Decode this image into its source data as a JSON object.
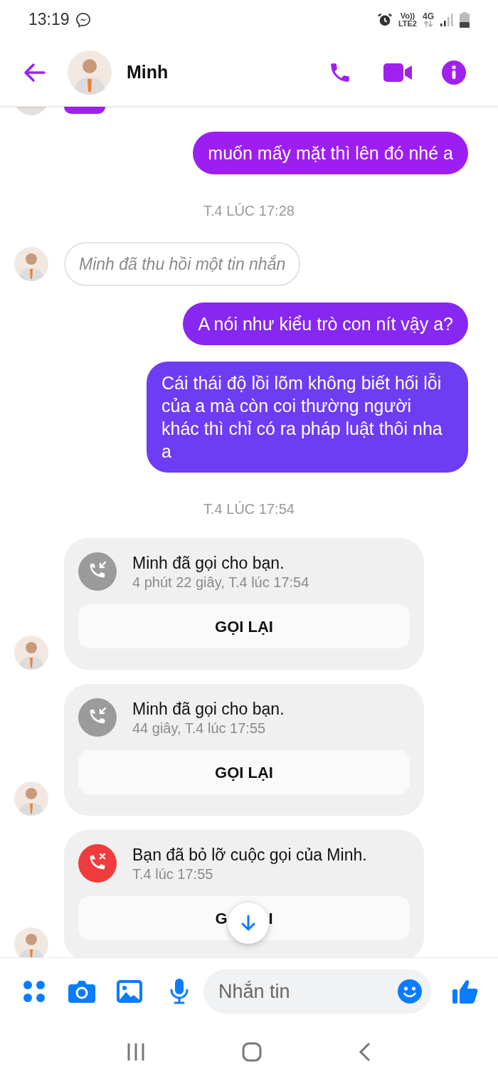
{
  "status_bar": {
    "time": "13:19",
    "volte": "Vo))",
    "lte": "LTE2",
    "data": "4G"
  },
  "header": {
    "name": "Minh"
  },
  "messages": [
    {
      "kind": "sent",
      "text": "muốn mấy mặt thì lên đó nhé a"
    },
    {
      "kind": "timestamp",
      "text": "T.4 LÚC 17:28"
    },
    {
      "kind": "recalled",
      "text": "Minh đã thu hồi một tin nhắn"
    },
    {
      "kind": "sent",
      "text": "A nói như kiểu trò con nít vậy a?"
    },
    {
      "kind": "sent",
      "text": "Cái thái độ lồi lõm không biết hối lỗi của a mà còn coi thường người khác thì chỉ có ra pháp luật thôi nha a"
    },
    {
      "kind": "timestamp",
      "text": "T.4 LÚC 17:54"
    },
    {
      "kind": "call",
      "missed": false,
      "title": "Minh đã gọi cho bạn.",
      "detail": "4 phút 22 giây, T.4 lúc 17:54",
      "button": "GỌI LẠI"
    },
    {
      "kind": "call",
      "missed": false,
      "title": "Minh đã gọi cho bạn.",
      "detail": "44 giây, T.4 lúc 17:55",
      "button": "GỌI LẠI"
    },
    {
      "kind": "call",
      "missed": true,
      "title": "Bạn đã bỏ lỡ cuộc gọi của Minh.",
      "detail": "T.4 lúc 17:55",
      "button_parts": [
        "G",
        "I"
      ]
    }
  ],
  "composer": {
    "placeholder": "Nhắn tin"
  }
}
